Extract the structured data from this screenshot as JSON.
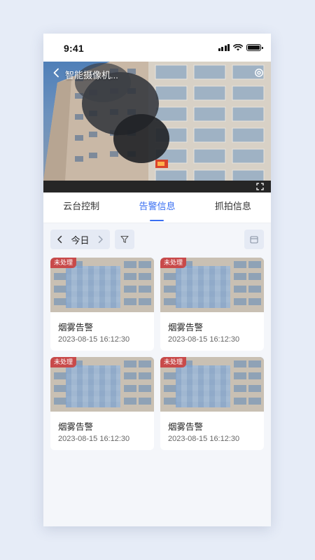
{
  "status_bar": {
    "time": "9:41"
  },
  "video": {
    "title": "智能摄像机...",
    "icons": {
      "back": "chevron-left-icon",
      "settings": "gear-icon",
      "fullscreen": "fullscreen-icon"
    }
  },
  "tabs": [
    {
      "label": "云台控制",
      "active": false
    },
    {
      "label": "告警信息",
      "active": true
    },
    {
      "label": "抓拍信息",
      "active": false
    }
  ],
  "toolbar": {
    "date_label": "今日",
    "icons": {
      "prev": "chevron-left-icon",
      "next": "chevron-right-icon",
      "filter": "filter-icon",
      "calendar": "calendar-icon"
    }
  },
  "alerts": [
    {
      "badge": "未处理",
      "title": "烟雾告警",
      "time": "2023-08-15 16:12:30"
    },
    {
      "badge": "未处理",
      "title": "烟雾告警",
      "time": "2023-08-15 16:12:30"
    },
    {
      "badge": "未处理",
      "title": "烟雾告警",
      "time": "2023-08-15 16:12:30"
    },
    {
      "badge": "未处理",
      "title": "烟雾告警",
      "time": "2023-08-15 16:12:30"
    }
  ],
  "colors": {
    "accent": "#3a6ff2",
    "badge": "#c84a4a",
    "background": "#f4f6fa"
  }
}
